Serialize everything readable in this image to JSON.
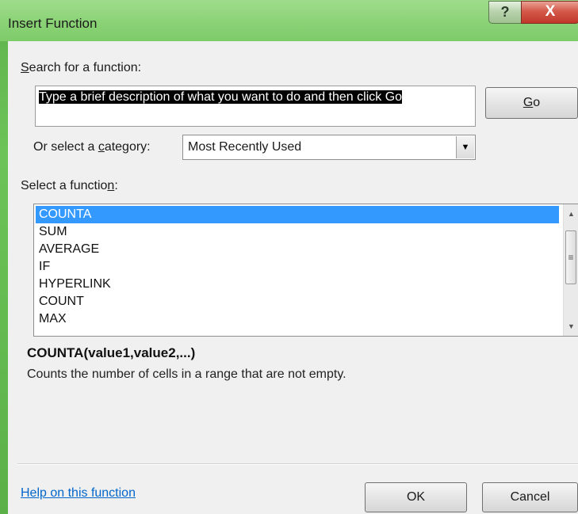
{
  "window": {
    "title": "Insert Function",
    "help_glyph": "?",
    "close_glyph": "X"
  },
  "search": {
    "label_mnemonic": "S",
    "label_rest": "earch for a function:",
    "value": "Type a brief description of what you want to do and then click Go",
    "go_mnemonic": "G",
    "go_rest": "o"
  },
  "category": {
    "label_pre": "Or select a ",
    "label_mnemonic": "c",
    "label_post": "ategory:",
    "selected": "Most Recently Used",
    "arrow_icon": "dropdown-arrow-icon"
  },
  "functions": {
    "label_pre": "Select a functio",
    "label_mnemonic": "n",
    "label_post": ":",
    "items": [
      {
        "label": "COUNTA",
        "selected": true
      },
      {
        "label": "SUM"
      },
      {
        "label": "AVERAGE"
      },
      {
        "label": "IF"
      },
      {
        "label": "HYPERLINK"
      },
      {
        "label": "COUNT"
      },
      {
        "label": "MAX"
      }
    ]
  },
  "details": {
    "signature": "COUNTA(value1,value2,...)",
    "description": "Counts the number of cells in a range that are not empty."
  },
  "footer": {
    "help_link": "Help on this function",
    "ok_label": "OK",
    "cancel_label": "Cancel"
  },
  "colors": {
    "frame": "#6cc458",
    "selection": "#3399ff",
    "link": "#0066cc",
    "close": "#c1372a"
  }
}
